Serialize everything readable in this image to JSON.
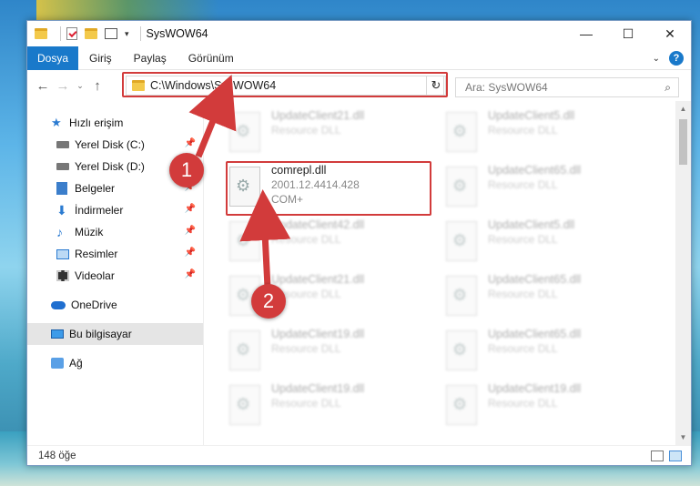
{
  "window": {
    "title": "SysWOW64",
    "controls": {
      "minimize": "—",
      "maximize": "☐",
      "close": "✕"
    }
  },
  "ribbon": {
    "tabs": [
      "Dosya",
      "Giriş",
      "Paylaş",
      "Görünüm"
    ],
    "help": "?"
  },
  "navigation": {
    "address": "C:\\Windows\\SysWOW64",
    "search_placeholder": "Ara: SysWOW64"
  },
  "sidebar": {
    "items": [
      {
        "label": "Hızlı erişim",
        "icon": "star-icon"
      },
      {
        "label": "Yerel Disk (C:)",
        "icon": "drive-icon",
        "pinned": true
      },
      {
        "label": "Yerel Disk (D:)",
        "icon": "drive-icon",
        "pinned": true
      },
      {
        "label": "Belgeler",
        "icon": "documents-icon",
        "pinned": true
      },
      {
        "label": "İndirmeler",
        "icon": "download-icon",
        "pinned": true
      },
      {
        "label": "Müzik",
        "icon": "music-icon",
        "pinned": true
      },
      {
        "label": "Resimler",
        "icon": "pictures-icon",
        "pinned": true
      },
      {
        "label": "Videolar",
        "icon": "videos-icon",
        "pinned": true
      },
      {
        "label": "OneDrive",
        "icon": "onedrive-icon"
      },
      {
        "label": "Bu bilgisayar",
        "icon": "computer-icon",
        "selected": true
      },
      {
        "label": "Ağ",
        "icon": "network-icon"
      }
    ]
  },
  "files": {
    "highlighted": {
      "name": "comrepl.dll",
      "version": "2001.12.4414.428",
      "description": "COM+"
    },
    "blurred": [
      {
        "name": "UpdateClient21.dll",
        "sub": "Resource DLL"
      },
      {
        "name": "UpdateClient5.dll",
        "sub": "Resource DLL"
      },
      {
        "name": "UpdateClient65.dll",
        "sub": "Resource DLL"
      },
      {
        "name": "UpdateClient42.dll",
        "sub": "Resource DLL"
      },
      {
        "name": "UpdateClient5.dll",
        "sub": "Resource DLL"
      },
      {
        "name": "UpdateClient21.dll",
        "sub": "Resource DLL"
      },
      {
        "name": "UpdateClient65.dll",
        "sub": "Resource DLL"
      },
      {
        "name": "UpdateClient19.dll",
        "sub": "Resource DLL"
      },
      {
        "name": "UpdateClient65.dll",
        "sub": "Resource DLL"
      },
      {
        "name": "UpdateClient19.dll",
        "sub": "Resource DLL"
      },
      {
        "name": "UpdateClient19.dll",
        "sub": "Resource DLL"
      }
    ]
  },
  "status": {
    "item_count": "148 öğe"
  },
  "annotations": {
    "marker1": "1",
    "marker2": "2"
  },
  "colors": {
    "accent": "#1979ca",
    "highlight": "#d23b3b"
  }
}
